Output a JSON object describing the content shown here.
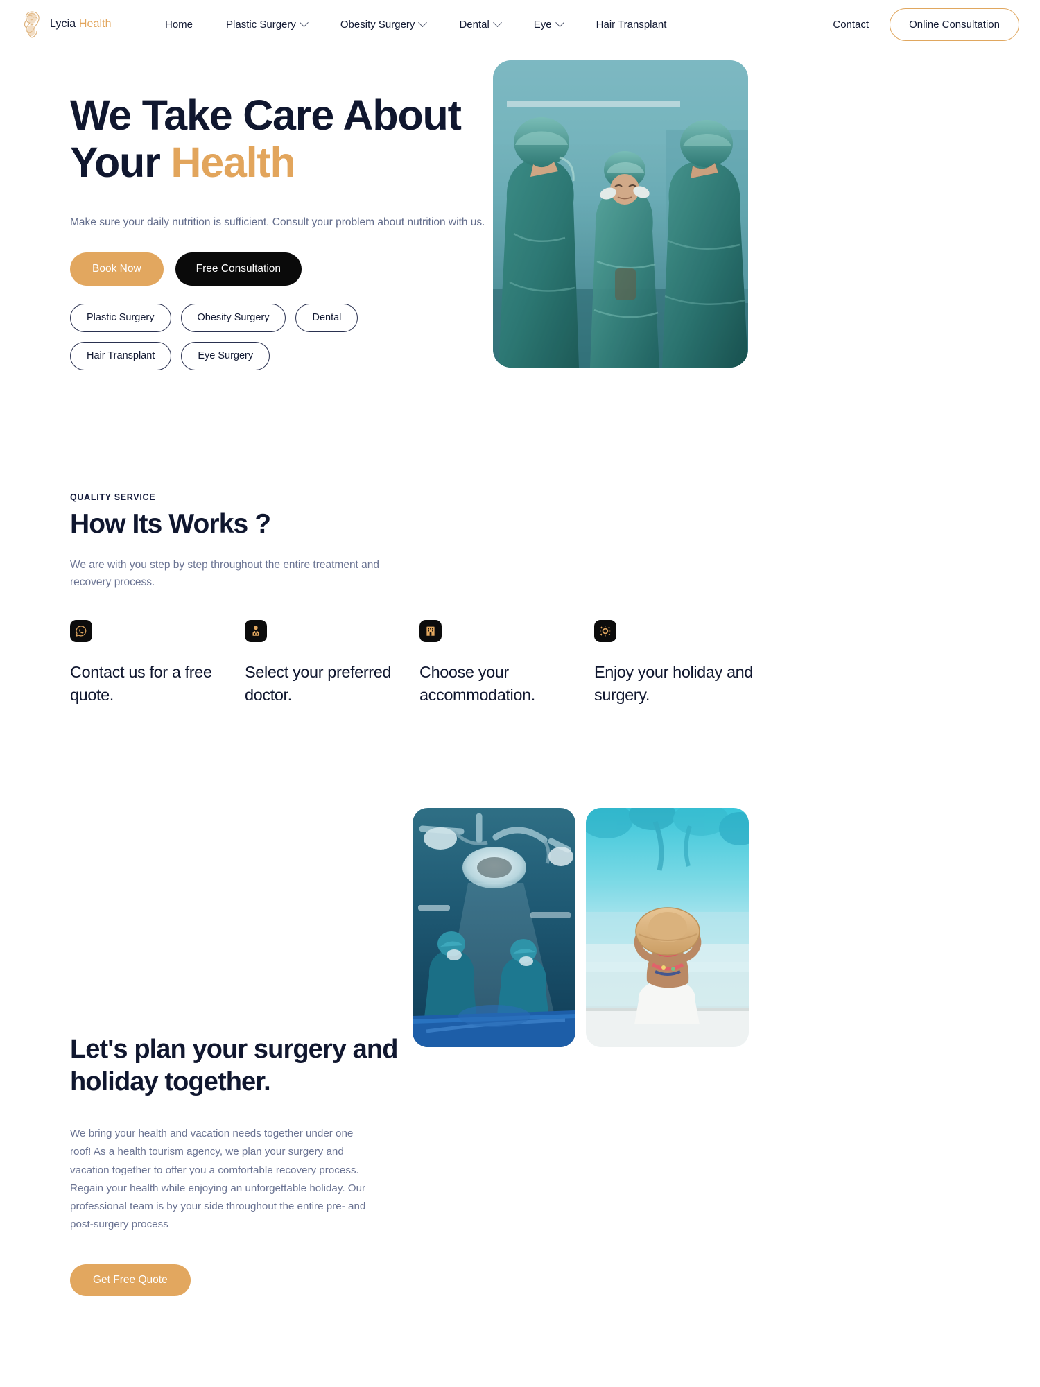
{
  "brand": {
    "name_part1": "Lycia",
    "name_part2": "Health",
    "logo_icon": "classical-woman-bust-icon"
  },
  "nav": {
    "items": [
      {
        "label": "Home",
        "has_dropdown": false
      },
      {
        "label": "Plastic Surgery",
        "has_dropdown": true
      },
      {
        "label": "Obesity Surgery",
        "has_dropdown": true
      },
      {
        "label": "Dental",
        "has_dropdown": true
      },
      {
        "label": "Eye",
        "has_dropdown": true
      },
      {
        "label": "Hair Transplant",
        "has_dropdown": false
      }
    ],
    "contact_label": "Contact",
    "consultation_label": "Online Consultation"
  },
  "hero": {
    "title_line1": "We Take Care About",
    "title_line2_plain": "Your ",
    "title_line2_accent": "Health",
    "subtitle": "Make sure your daily nutrition is sufficient. Consult your problem about nutrition with us.",
    "primary_cta": "Book Now",
    "secondary_cta": "Free Consultation",
    "tags": [
      "Plastic Surgery",
      "Obesity Surgery",
      "Dental",
      "Hair Transplant",
      "Eye Surgery"
    ],
    "image_alt": "surgical-team-operating-room"
  },
  "works": {
    "eyebrow": "QUALITY SERVICE",
    "title": "How Its Works ?",
    "subtitle": "We are with you step by step throughout the entire treatment and recovery process.",
    "steps": [
      {
        "icon": "whatsapp-icon",
        "title": "Contact us for a free quote."
      },
      {
        "icon": "doctor-icon",
        "title": "Select your preferred doctor."
      },
      {
        "icon": "hotel-icon",
        "title": "Choose your accommodation."
      },
      {
        "icon": "sun-icon",
        "title": "Enjoy your holiday and surgery."
      }
    ]
  },
  "plan": {
    "title": "Let's plan your surgery and holiday together.",
    "body": "We bring your health and vacation needs together under one roof! As a health tourism agency, we plan your surgery and vacation together to offer you a comfortable recovery process. Regain your health while enjoying an unforgettable holiday. Our professional team is by your side throughout the entire pre- and post-surgery process",
    "cta": "Get Free Quote",
    "image_left_alt": "operating-room-surgical-lights",
    "image_right_alt": "woman-with-sun-hat-at-pool"
  },
  "colors": {
    "accent_gold": "#e2a75f",
    "navy": "#10172f",
    "muted_text": "#6b7493",
    "dark_button": "#0a0a0a"
  }
}
